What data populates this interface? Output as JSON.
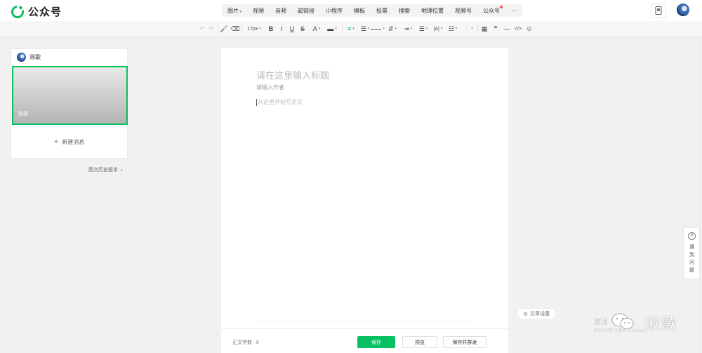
{
  "brand": {
    "name": "公众号"
  },
  "insert_menu": {
    "group1": [
      {
        "label": "图片",
        "caret": "▾"
      },
      {
        "label": "视频"
      },
      {
        "label": "音频"
      }
    ],
    "group2": [
      {
        "label": "超链接"
      },
      {
        "label": "小程序"
      },
      {
        "label": "模板"
      },
      {
        "label": "投票"
      },
      {
        "label": "搜索"
      },
      {
        "label": "地理位置"
      },
      {
        "label": "视频号"
      },
      {
        "label": "公众号",
        "badge": true
      },
      {
        "label": "···"
      }
    ]
  },
  "toolbar": {
    "undo": "↶",
    "redo": "↷",
    "format_painter": "🖌",
    "clear_format": "⌫",
    "font_size": "17px",
    "bold": "B",
    "italic": "I",
    "underline": "U",
    "strikethrough": "S",
    "font_color": "A",
    "background_color": "▬",
    "align": "≡",
    "indent": "☰",
    "line_height": "⩶",
    "paragraph_spacing": "⇵",
    "first_line_indent": "⇥",
    "letter_spacing": "|A|",
    "list": "☷",
    "ordered": "⋮",
    "table": "▦",
    "quote": "❞",
    "divider": "—",
    "code": "</>",
    "emoji": "☺"
  },
  "left_panel": {
    "account_name": "湫歌",
    "cover_title": "标题",
    "new_message": "新建消息",
    "new_message_icon": "+",
    "history": "图文历史版本",
    "history_caret": "▾"
  },
  "editor": {
    "title_placeholder": "请在这里输入标题",
    "author_placeholder": "请输入作者",
    "body_placeholder": "从这里开始写正文",
    "word_count_label": "正文字数",
    "word_count": "0",
    "save": "保存",
    "preview": "预览",
    "save_publish": "保存并群发"
  },
  "side": {
    "article_settings": "文章设置",
    "help": "遇到问题",
    "help_icon": "?"
  },
  "watermark": {
    "activate": "激活",
    "activate_sub": "转到\"设置\"以激活 Windows。",
    "name": "湫歌"
  },
  "colors": {
    "accent": "#07c160",
    "badge": "#fa5151"
  }
}
